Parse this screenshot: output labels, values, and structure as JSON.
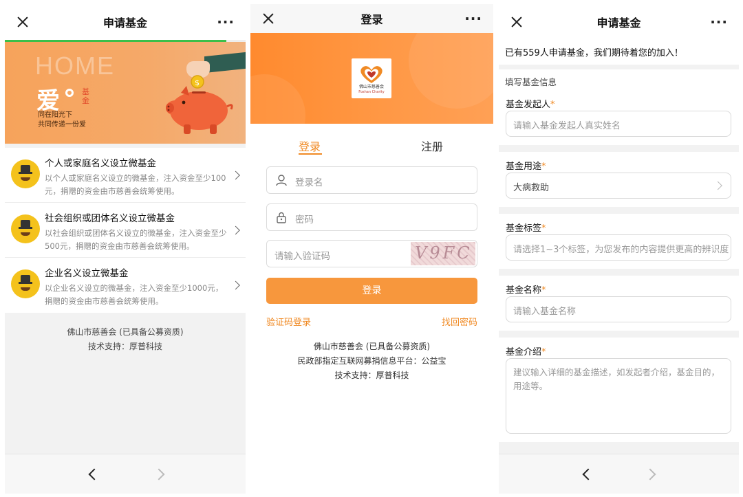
{
  "panel1": {
    "nav": {
      "title": "申请基金",
      "more": "···"
    },
    "banner": {
      "home": "HOME",
      "love": "爱",
      "fund": "基金",
      "slogan_line1": "同在阳光下",
      "slogan_line2": "共同传递一份爱"
    },
    "items": [
      {
        "title": "个人或家庭名义设立微基金",
        "desc": "以个人或家庭名义设立的微基金，注入资金至少100元，捐赠的资金由市慈善会统筹使用。"
      },
      {
        "title": "社会组织或团体名义设立微基金",
        "desc": "以社会组织或团体名义设立的微基金，注入资金至少500元，捐赠的资金由市慈善会统筹使用。"
      },
      {
        "title": "企业名义设立微基金",
        "desc": "以企业名义设立的微基金，注入资金至少1000元，捐赠的资金由市慈善会统筹使用。"
      }
    ],
    "footer_line1": "佛山市慈善会 (已具备公募资质)",
    "footer_line2": "技术支持：厚普科技"
  },
  "panel2": {
    "nav": {
      "title": "登录",
      "more": "···"
    },
    "logo": {
      "name": "佛山市慈善会",
      "english": "Foshan Charity"
    },
    "tabs": {
      "login": "登录",
      "register": "注册"
    },
    "username_placeholder": "登录名",
    "password_placeholder": "密码",
    "captcha_placeholder": "请输入验证码",
    "captcha_text": "V9FC",
    "login_button": "登录",
    "sms_login_link": "验证码登录",
    "forgot_link": "找回密码",
    "footer_line1": "佛山市慈善会 (已具备公募资质)",
    "footer_line2": "民政部指定互联网募捐信息平台：公益宝",
    "footer_line3": "技术支持：厚普科技"
  },
  "panel3": {
    "nav": {
      "title": "申请基金",
      "more": "···"
    },
    "notice": "已有559人申请基金，我们期待着您的加入！",
    "section_title": "填写基金信息",
    "required_mark": "*",
    "fields": {
      "sponsor_label": "基金发起人",
      "sponsor_placeholder": "请输入基金发起人真实姓名",
      "purpose_label": "基金用途",
      "purpose_value": "大病救助",
      "tags_label": "基金标签",
      "tags_placeholder": "请选择1~3个标签，为您发布的内容提供更高的辨识度",
      "name_label": "基金名称",
      "name_placeholder": "请输入基金名称",
      "intro_label": "基金介绍",
      "intro_placeholder": "建议输入详细的基金描述，如发起者介绍，基金目的，用途等。"
    }
  },
  "colors": {
    "accent": "#f08a24",
    "button": "#f7973d",
    "progress": "#3cbf4a",
    "avatar": "#f4c21c"
  },
  "page_load_progress": 0.92
}
